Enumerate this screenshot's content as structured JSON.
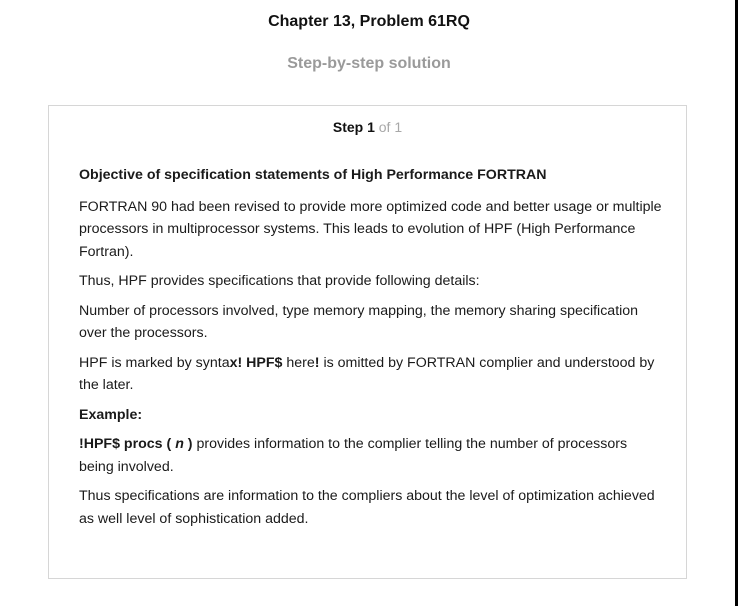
{
  "header": {
    "chapter_title": "Chapter 13, Problem 61RQ",
    "subtitle": "Step-by-step solution"
  },
  "step": {
    "label": "Step 1",
    "of_text": " of 1",
    "objective_heading": "Objective of specification statements of High Performance FORTRAN",
    "para1": "FORTRAN 90 had been revised to provide more optimized code and better usage or multiple processors in multiprocessor systems. This leads to evolution of HPF (High Performance Fortran).",
    "para2": "Thus, HPF provides specifications that provide following details:",
    "para3": "Number of processors involved, type memory mapping, the memory sharing specification over the processors.",
    "para4": {
      "t1": "HPF is marked by synta",
      "b1": "x! HPF$",
      "t2": " here",
      "b2": "!",
      "t3": " is omitted by FORTRAN complier and understood by the later."
    },
    "example_heading": "Example:",
    "para5": {
      "b1": "!HPF$ procs ( ",
      "bi": "n",
      "b2": " )",
      "t1": " provides information to the complier telling the number of processors being involved."
    },
    "para6": "Thus specifications are information to the compliers about the level of optimization achieved as well level of sophistication added."
  }
}
